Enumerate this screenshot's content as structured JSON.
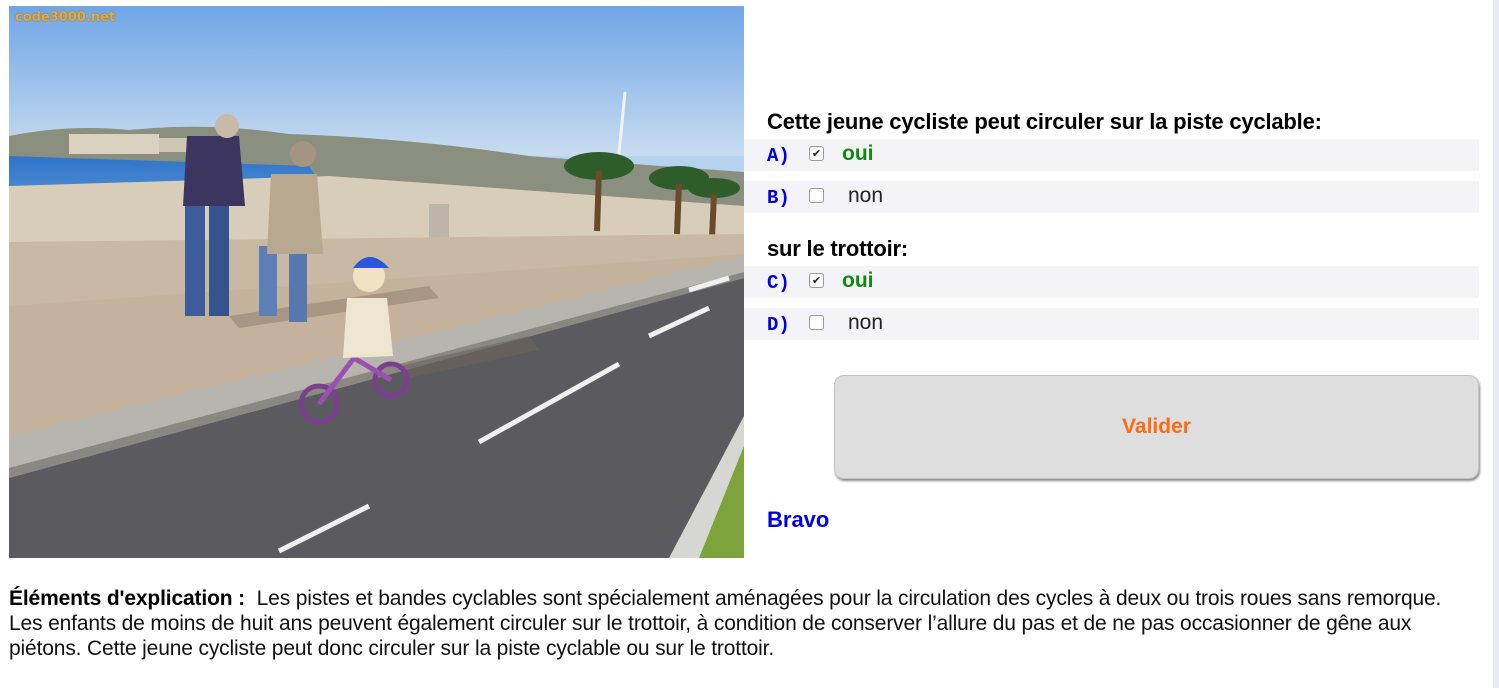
{
  "photo": {
    "watermark": "code3000.net"
  },
  "quiz": {
    "question1": "Cette jeune cycliste peut circuler sur la piste cyclable:",
    "question2": "sur le trottoir:",
    "answers": [
      {
        "letter": "A)",
        "text": "oui",
        "checked": true
      },
      {
        "letter": "B)",
        "text": "non",
        "checked": false
      },
      {
        "letter": "C)",
        "text": "oui",
        "checked": true
      },
      {
        "letter": "D)",
        "text": "non",
        "checked": false
      }
    ],
    "validate_label": "Valider",
    "feedback": "Bravo"
  },
  "explanation": {
    "label": "Éléments d'explication :",
    "text": "Les pistes et bandes cyclables sont spécialement aménagées pour la circulation des cycles à deux ou trois roues sans remorque. Les enfants de moins de huit ans peuvent également circuler sur le trottoir, à condition de conserver l’allure du pas et de ne pas occasionner de gêne aux piétons. Cette jeune cycliste peut donc circuler sur la piste cyclable ou sur le trottoir."
  },
  "colors": {
    "accent_blue": "#0000e0",
    "correct_green": "#118811",
    "button_text": "#ff6a13"
  }
}
